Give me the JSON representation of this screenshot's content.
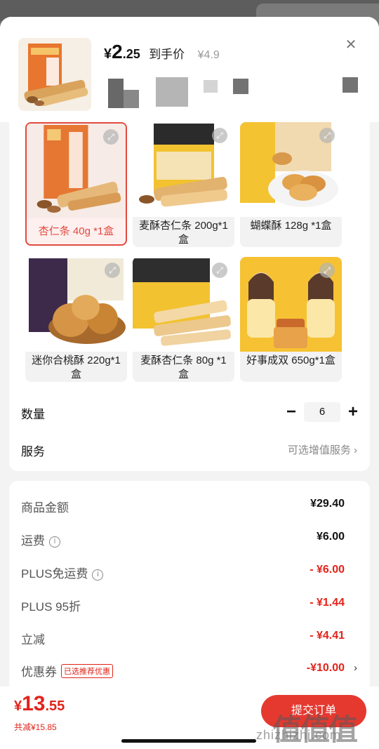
{
  "header": {
    "price_symbol": "¥",
    "price_integer": "2",
    "price_decimal": ".25",
    "price_label": "到手价",
    "original_price": "¥4.9",
    "close_icon": "close-icon"
  },
  "variants": [
    {
      "label": "杏仁条 40g *1盒",
      "selected": true
    },
    {
      "label": "麦酥杏仁条 200g*1盒",
      "selected": false
    },
    {
      "label": "蝴蝶酥 128g *1盒",
      "selected": false
    },
    {
      "label": "迷你合桃酥 220g*1盒",
      "selected": false
    },
    {
      "label": "麦酥杏仁条 80g *1盒",
      "selected": false
    },
    {
      "label": "好事成双 650g*1盒",
      "selected": false
    }
  ],
  "quantity": {
    "label": "数量",
    "minus": "−",
    "value": "6",
    "plus": "+"
  },
  "service": {
    "label": "服务",
    "value": "可选增值服务 ›"
  },
  "fees": {
    "goods_label": "商品金额",
    "goods_value": "¥29.40",
    "shipping_label": "运费",
    "shipping_value": "¥6.00",
    "plus_ship_label": "PLUS免运费",
    "plus_ship_value": "- ¥6.00",
    "plus_discount_label": "PLUS 95折",
    "plus_discount_value": "- ¥1.44",
    "instant_label": "立减",
    "instant_value": "- ¥4.41",
    "coupon_label": "优惠券",
    "coupon_tag": "已选推荐优惠",
    "coupon_value": "-¥10.00",
    "chevron": "›"
  },
  "footer": {
    "total_symbol": "¥",
    "total_integer": "13",
    "total_decimal": ".55",
    "saved": "共减¥15.85",
    "submit": "提交订单"
  },
  "watermark": {
    "logo": "值值值",
    "url": "zhizhizhi.com"
  },
  "colors": {
    "accent": "#e2231a",
    "selected_border": "#e24a3f"
  }
}
